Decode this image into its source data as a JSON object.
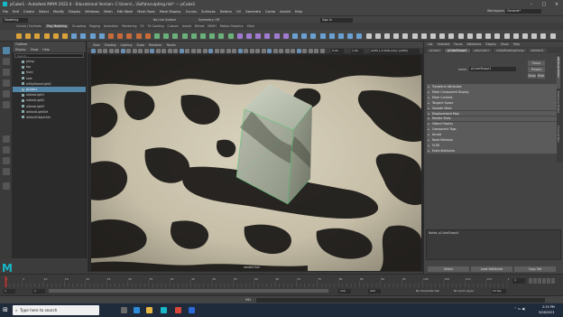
{
  "window": {
    "title": "pCube1 - Autodesk MAYA 2022.4 - Educational Version: C:\\Users\\...\\Sofia\\sculpting.mb* --- pCube1"
  },
  "menubar": {
    "items": [
      "File",
      "Edit",
      "Create",
      "Select",
      "Modify",
      "Display",
      "Windows",
      "Mesh",
      "Edit Mesh",
      "Mesh Tools",
      "Mesh Display",
      "Curves",
      "Surfaces",
      "Deform",
      "UV",
      "Generate",
      "Cache",
      "Arnold",
      "Help"
    ],
    "workspace_label": "Workspace:",
    "workspace_value": "General*"
  },
  "statusline": {
    "mode": "Modeling",
    "no_live_surface": "No Live Surface",
    "symmetry": "Symmetry: Off",
    "sign_in": "Sign In"
  },
  "shelf": {
    "tabs": [
      "Curves / Surfaces",
      "Poly Modeling",
      "Sculpting",
      "Rigging",
      "Animation",
      "Rendering",
      "FX",
      "FX Caching",
      "Custom",
      "Arnold",
      "Bifrost",
      "MASH",
      "Motion Graphics",
      "XGen"
    ],
    "active_tab": "Poly Modeling"
  },
  "outliner": {
    "title": "Outliner",
    "menus": [
      "Display",
      "Show",
      "Help"
    ],
    "search_placeholder": "Search...",
    "items": [
      "persp",
      "top",
      "front",
      "side",
      "aiSkyDomeLight1",
      "pCube1",
      "aiAreaLight1",
      "aiAreaLight2",
      "aiAreaLight3",
      "defaultLightSet",
      "defaultObjectSet"
    ],
    "selected": "pCube1"
  },
  "viewport": {
    "menus": [
      "View",
      "Shading",
      "Lighting",
      "Show",
      "Renderer",
      "Panels"
    ],
    "value1": "0.00",
    "value2": "1.00",
    "colorspace": "ACES 1.0 SDR-video (ACES)",
    "camera_label": "renderCam"
  },
  "attribute_editor": {
    "menus": [
      "List",
      "Selected",
      "Focus",
      "Attributes",
      "Display",
      "Show",
      "Help"
    ],
    "tabs": [
      "pCube1",
      "pCubeShape1",
      "polyCube1",
      "initialShadingGroup",
      "lambert1"
    ],
    "active_tab": "pCubeShape1",
    "mesh_label": "mesh:",
    "mesh_value": "pCubeShape1",
    "focus_button": "Focus",
    "presets_button": "Presets",
    "show_button": "Show",
    "hide_button": "Hide",
    "sections": [
      "Transform Attributes",
      "Mesh Component Display",
      "Mesh Controls",
      "Tangent Space",
      "Smooth Mesh",
      "Displacement Map",
      "Render Stats",
      "Object Display",
      "Component Tags",
      "Arnold",
      "Node Behavior",
      "UUID",
      "Extra Attributes"
    ],
    "notes_label": "Notes: pCubeShape1",
    "select_button": "Select",
    "load_attributes_button": "Load Attributes",
    "copy_tab_button": "Copy Tab",
    "side_tabs": [
      "Attribute Editor",
      "Modeling Toolkit",
      "Channel Box"
    ]
  },
  "timeline": {
    "ticks": [
      "1",
      "5",
      "10",
      "15",
      "20",
      "25",
      "30",
      "35",
      "40",
      "45",
      "50",
      "55",
      "60",
      "65",
      "70",
      "75",
      "80",
      "85",
      "90",
      "95",
      "100",
      "105",
      "110",
      "115",
      "120"
    ],
    "current_frame": "1"
  },
  "range": {
    "start": "1",
    "start_inner": "1",
    "end_inner": "120",
    "end": "200",
    "fps": "24 fps",
    "no_character_set": "No Character Set",
    "no_anim_layer": "No Anim Layer"
  },
  "cmdline": {
    "label": "MEL"
  },
  "taskbar": {
    "search_placeholder": "Type here to search",
    "time": "2:15 PM",
    "date": "5/28/2023"
  },
  "colors": {
    "selection": "#5285a6",
    "maya_logo": "#17b8c8"
  }
}
